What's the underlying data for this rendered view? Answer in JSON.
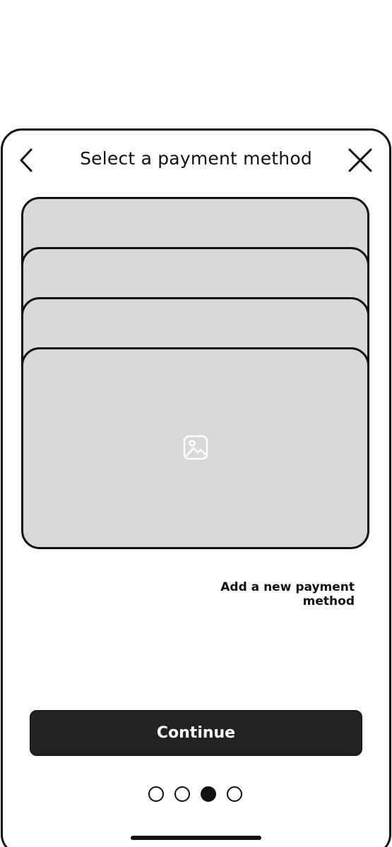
{
  "header": {
    "title": "Select a payment method",
    "back_icon": "chevron-left-icon",
    "close_icon": "close-icon"
  },
  "cards": [
    {
      "icon": "none"
    },
    {
      "icon": "none"
    },
    {
      "icon": "none"
    },
    {
      "icon": "image-placeholder-icon"
    }
  ],
  "actions": {
    "add_payment_label": "Add a new payment method",
    "continue_label": "Continue"
  },
  "pagination": {
    "total": 4,
    "active_index": 3
  },
  "colors": {
    "card_fill": "#d9d9d9",
    "outline": "#111111",
    "button_fill": "#222224",
    "button_text": "#ffffff"
  }
}
